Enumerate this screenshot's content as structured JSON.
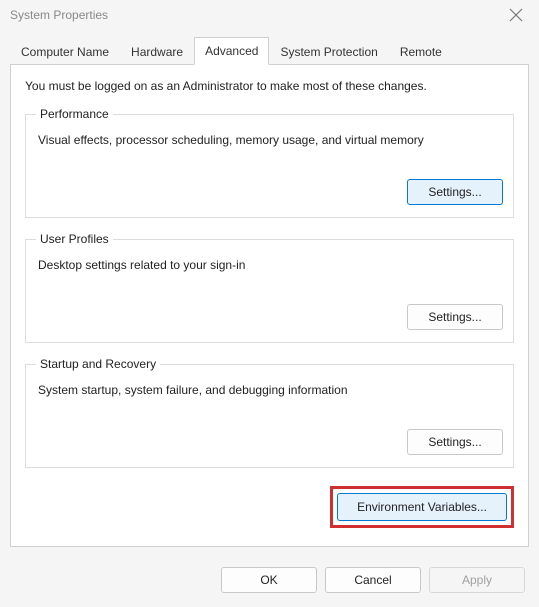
{
  "title": "System Properties",
  "tabs": {
    "computerName": "Computer Name",
    "hardware": "Hardware",
    "advanced": "Advanced",
    "systemProtection": "System Protection",
    "remote": "Remote"
  },
  "intro": "You must be logged on as an Administrator to make most of these changes.",
  "performance": {
    "legend": "Performance",
    "desc": "Visual effects, processor scheduling, memory usage, and virtual memory",
    "settings": "Settings..."
  },
  "userProfiles": {
    "legend": "User Profiles",
    "desc": "Desktop settings related to your sign-in",
    "settings": "Settings..."
  },
  "startupRecovery": {
    "legend": "Startup and Recovery",
    "desc": "System startup, system failure, and debugging information",
    "settings": "Settings..."
  },
  "envVarsButton": "Environment Variables...",
  "dialogButtons": {
    "ok": "OK",
    "cancel": "Cancel",
    "apply": "Apply"
  }
}
